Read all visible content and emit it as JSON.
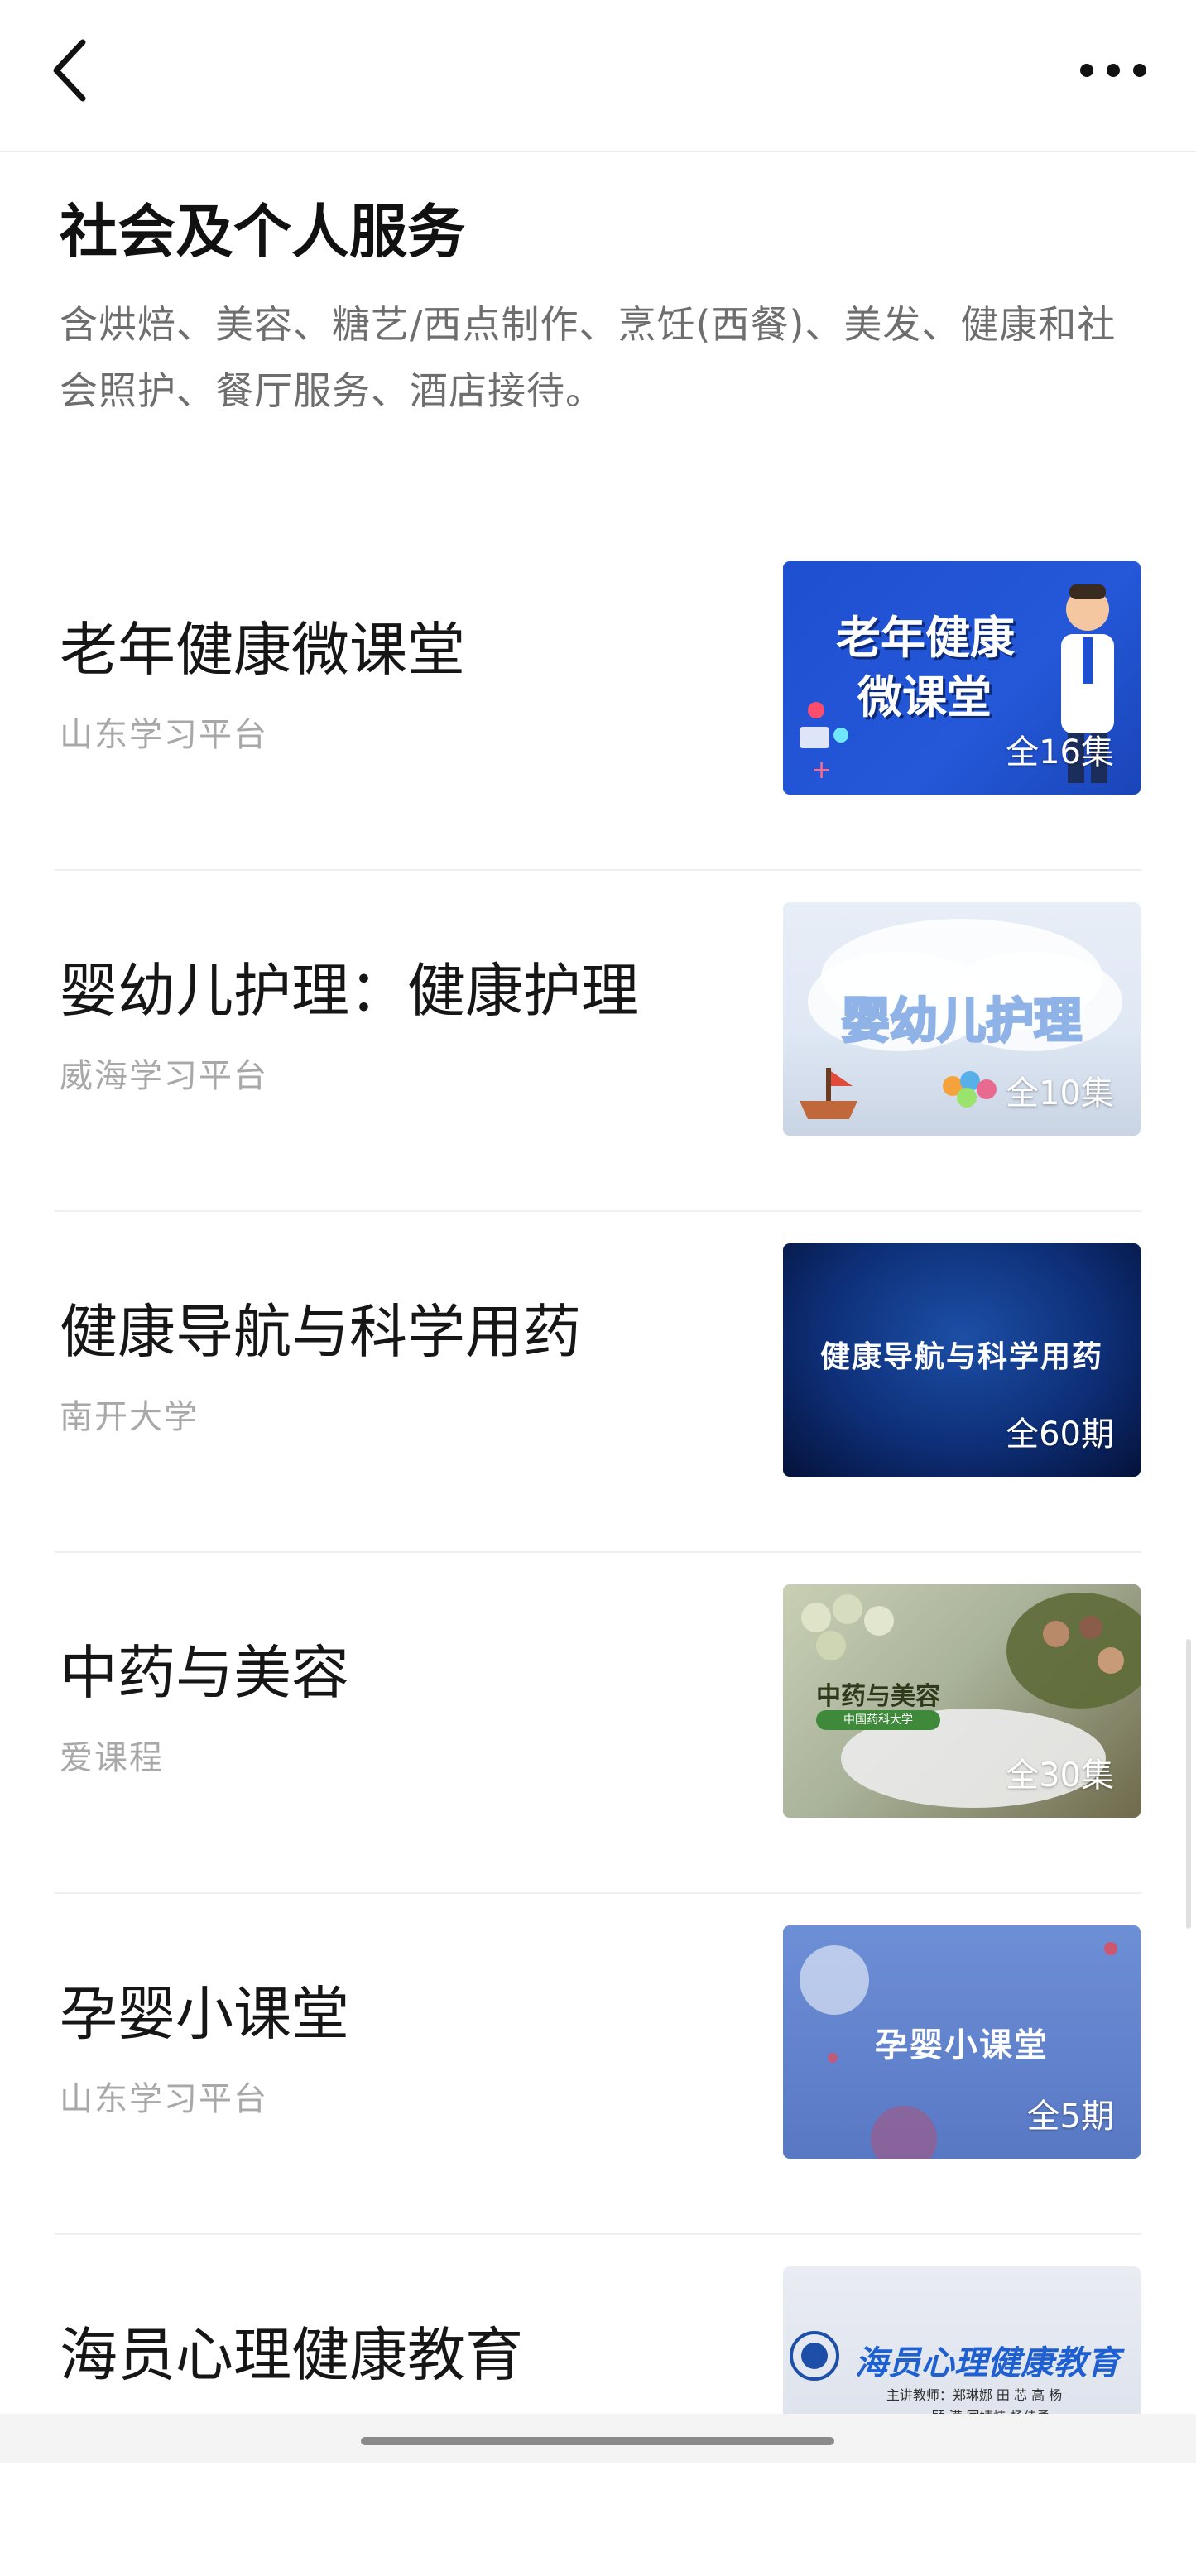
{
  "header": {
    "back_icon": "chevron-left-icon",
    "more_icon": "ellipsis-icon"
  },
  "section": {
    "title": "社会及个人服务",
    "description": "含烘焙、美容、糖艺/西点制作、烹饪(西餐)、美发、健康和社会照护、餐厅服务、酒店接待。"
  },
  "courses": [
    {
      "title": "老年健康微课堂",
      "source": "山东学习平台",
      "thumb_line1": "老年健康",
      "thumb_line2": "微课堂",
      "count": "全16集"
    },
    {
      "title": "婴幼儿护理：健康护理",
      "source": "威海学习平台",
      "thumb_line1": "婴幼儿护理",
      "count": "全10集"
    },
    {
      "title": "健康导航与科学用药",
      "source": "南开大学",
      "thumb_line1": "健康导航与科学用药",
      "count": "全60期"
    },
    {
      "title": "中药与美容",
      "source": "爱课程",
      "thumb_line1": "中药与美容",
      "thumb_line2": "中国药科大学",
      "count": "全30集"
    },
    {
      "title": "孕婴小课堂",
      "source": "山东学习平台",
      "thumb_line1": "孕婴小课堂",
      "count": "全5期"
    },
    {
      "title": "海员心理健康教育",
      "source": "",
      "thumb_line1": "海员心理健康教育",
      "thumb_line2": "主讲教师：郑琳娜 田 芯 高 杨",
      "thumb_line3": "顾 滢 国婧炜 杨佳勇"
    }
  ]
}
